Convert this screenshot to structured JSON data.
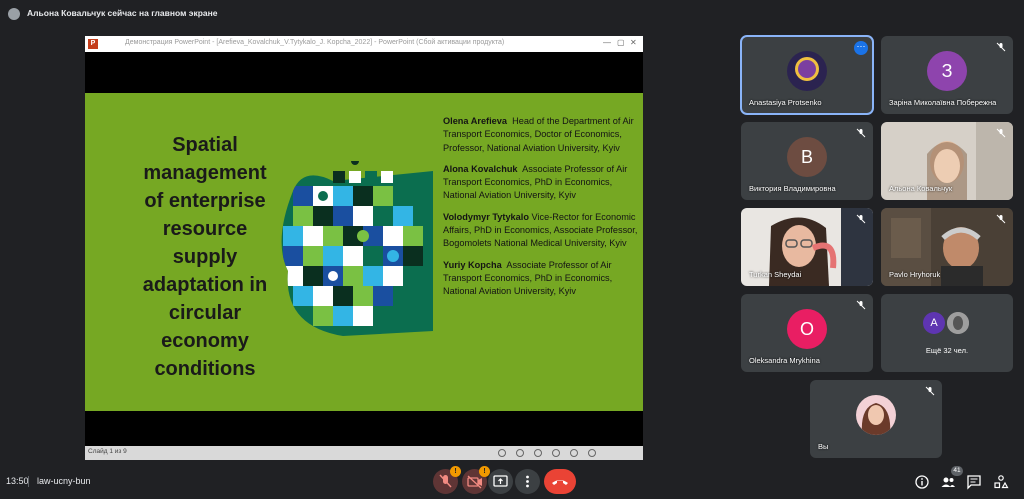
{
  "topbar": {
    "presenting_label": "Альона Ковальчук сейчас на главном экране"
  },
  "window": {
    "title": "Демонстрация PowerPoint - [Arefieva_Kovalchuk_V.Tytykalo_J. Kopcha_2022] - PowerPoint (Сбой активации продукта)",
    "app_icon": "P"
  },
  "slide": {
    "title_lines": [
      "Spatial",
      "management",
      "of enterprise",
      "resource",
      "supply",
      "adaptation in",
      "circular",
      "economy",
      "conditions"
    ],
    "authors": [
      {
        "name": "Olena Arefieva",
        "desc": "Head of the Department of Air Transport Economics, Doctor of Economics, Professor, National Aviation University, Kyiv"
      },
      {
        "name": "Alona Kovalchuk",
        "desc": "Associate Professor of Air Transport Economics, PhD in Economics, National Aviation University, Kyiv"
      },
      {
        "name": "Volodymyr Tytykalo",
        "desc": "Vice-Rector for Economic Affairs, PhD in Economics, Associate Professor, Bogomolets National Medical University, Kyiv"
      },
      {
        "name": "Yuriy Kopcha",
        "desc": "Associate Professor of Air Transport Economics, PhD in Economics, National Aviation University, Kyiv"
      }
    ],
    "status": "Слайд 1 из 9"
  },
  "participants": [
    {
      "name": "Anastasiya Protsenko",
      "kind": "photo",
      "active": true
    },
    {
      "name": "Зарiна Миколаївна Побережна",
      "kind": "letter",
      "letter": "З",
      "color": "#8e44ad"
    },
    {
      "name": "Виктория Владимировна",
      "kind": "letter",
      "letter": "В",
      "color": "#6d4c41"
    },
    {
      "name": "Альона Ковальчук",
      "kind": "video"
    },
    {
      "name": "Turkan Sheydai",
      "kind": "video"
    },
    {
      "name": "Pavlo Hryhoruk",
      "kind": "video"
    },
    {
      "name": "Oleksandra Mrykhina",
      "kind": "letter",
      "letter": "O",
      "color": "#e91e63"
    },
    {
      "name": "Ещё 32 чел.",
      "kind": "more",
      "letter": "А",
      "color": "#5e35b1"
    },
    {
      "name": "Вы",
      "kind": "photo"
    }
  ],
  "bottombar": {
    "time": "13:50",
    "meeting_code": "law-ucny-bun",
    "mic_badge": "!",
    "cam_badge": "!",
    "people_count": "41"
  },
  "colors": {
    "slide_bg": "#76a823",
    "active_border": "#8ab4f8",
    "end_call": "#ea4335"
  }
}
